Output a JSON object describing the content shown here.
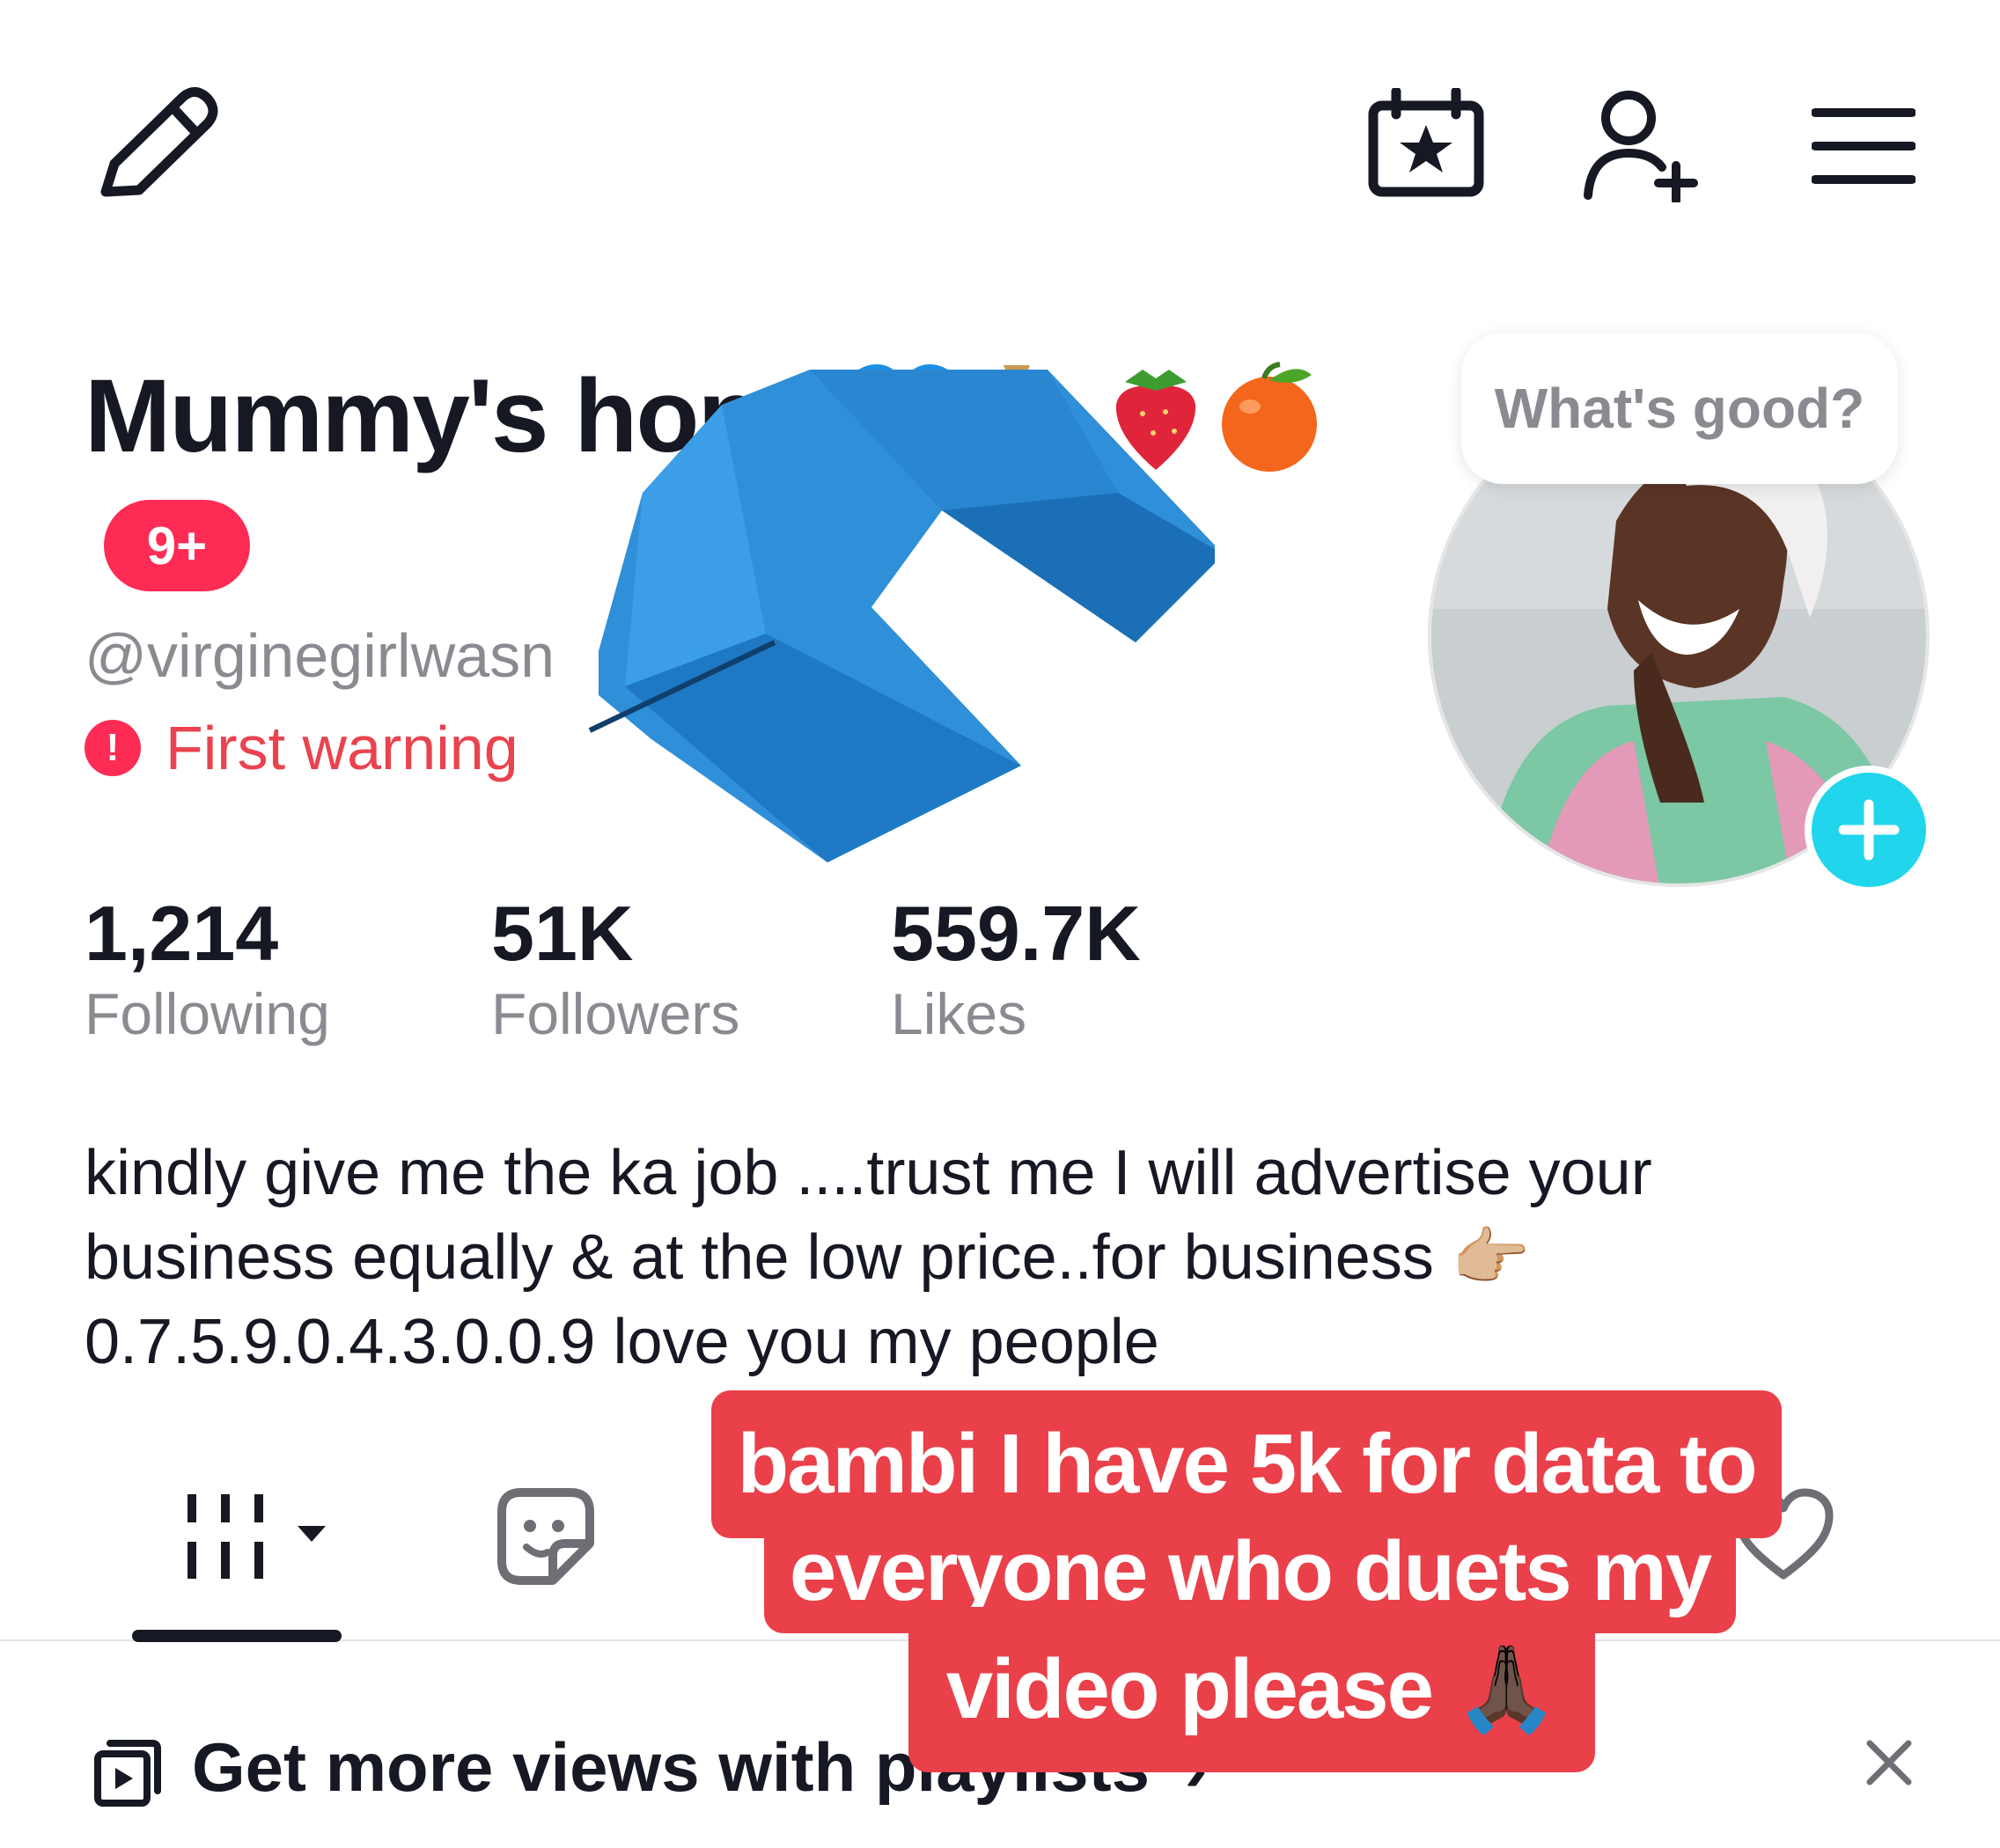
{
  "header": {
    "edit_icon": "pencil-icon",
    "calendar_icon": "calendar-star-icon",
    "add_friend_icon": "add-user-icon",
    "menu_icon": "hamburger-menu-icon"
  },
  "profile": {
    "display_name": "Mummy's hope",
    "name_emojis": [
      "blue-heart-emoji",
      "money-bag-emoji",
      "strawberry-emoji",
      "tangerine-emoji"
    ],
    "notification_badge": "9+",
    "handle": "@virginegirlwasn",
    "warning_label": "First warning",
    "warning_icon_glyph": "!",
    "avatar_bubble": "What's good?",
    "avatar_add_icon": "plus-icon"
  },
  "stats": [
    {
      "value": "1,214",
      "label": "Following"
    },
    {
      "value": "51K",
      "label": "Followers"
    },
    {
      "value": "559.7K",
      "label": "Likes"
    }
  ],
  "bio": {
    "line1": "kindly give me the ka job ....trust me I will advertise your",
    "line2": "business equally & at the low price..for business 👉🏼",
    "line3": "0.7.5.9.0.4.3.0.0.9 love you my people"
  },
  "tabs": [
    {
      "name": "videos-grid",
      "icon": "grid-icon",
      "active": true
    },
    {
      "name": "stickers",
      "icon": "sticker-icon",
      "active": false
    },
    {
      "name": "liked",
      "icon": "heart-icon",
      "active": false
    }
  ],
  "banner": {
    "icon": "playlist-icon",
    "text": "Get more views with playlists",
    "chevron": "›",
    "close_icon": "close-icon"
  },
  "caption_overlay": {
    "line1": "bambi I have 5k for data to",
    "line2": "everyone who duets my",
    "line3": "video please 🙏🏿"
  },
  "overlay_sticker": "blue-arrow-sticker",
  "colors": {
    "badge_red": "#fe2c55",
    "warning_red": "#e8434f",
    "caption_red": "#ea404a",
    "avatar_add_cyan": "#20d5ec",
    "muted_gray": "#8a8b91",
    "text_dark": "#161823",
    "arrow_blue": "#2f8fd8"
  }
}
